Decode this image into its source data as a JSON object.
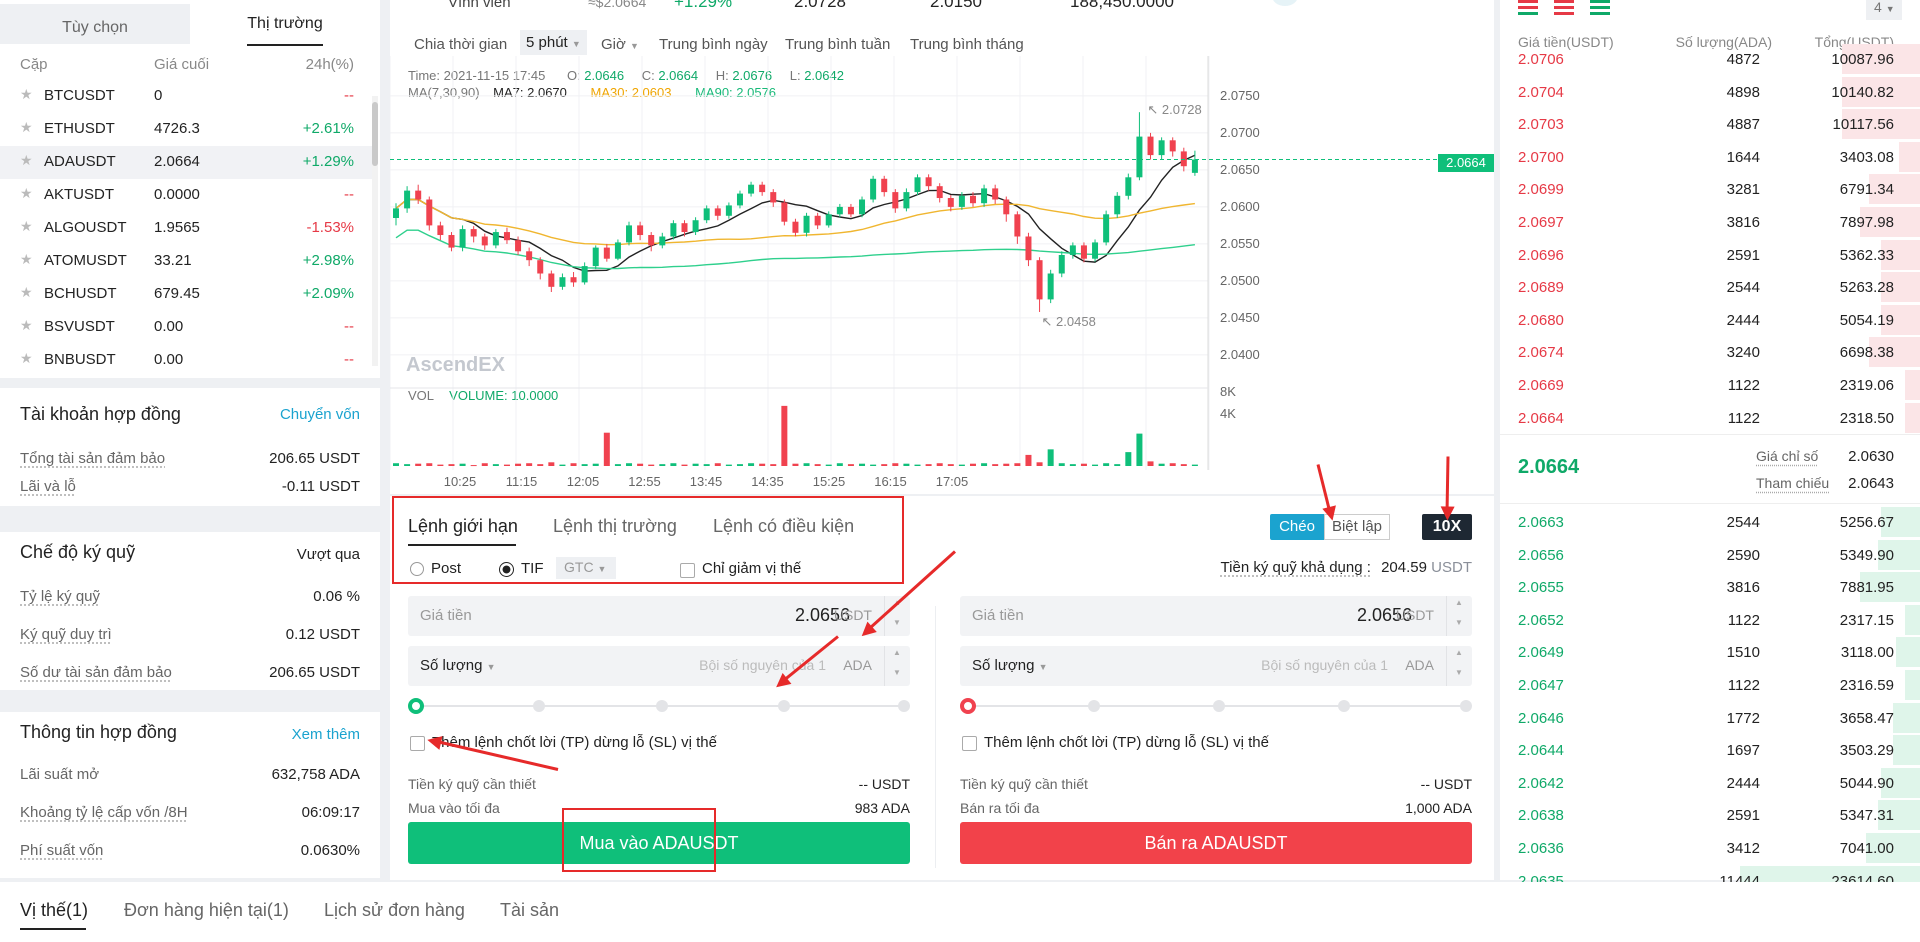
{
  "left": {
    "tabs": [
      "Tùy chọn",
      "Thị trường"
    ],
    "headers": [
      "Cặp",
      "Giá cuối",
      "24h(%)"
    ],
    "markets": [
      {
        "sym": "BTCUSDT",
        "price": "0",
        "chg": "--",
        "dir": "red"
      },
      {
        "sym": "ETHUSDT",
        "price": "4726.3",
        "chg": "+2.61%",
        "dir": "green"
      },
      {
        "sym": "ADAUSDT",
        "price": "2.0664",
        "chg": "+1.29%",
        "dir": "green"
      },
      {
        "sym": "AKTUSDT",
        "price": "0.0000",
        "chg": "--",
        "dir": "red"
      },
      {
        "sym": "ALGOUSDT",
        "price": "1.9565",
        "chg": "-1.53%",
        "dir": "red"
      },
      {
        "sym": "ATOMUSDT",
        "price": "33.21",
        "chg": "+2.98%",
        "dir": "green"
      },
      {
        "sym": "BCHUSDT",
        "price": "679.45",
        "chg": "+2.09%",
        "dir": "green"
      },
      {
        "sym": "BSVUSDT",
        "price": "0.00",
        "chg": "--",
        "dir": "red"
      },
      {
        "sym": "BNBUSDT",
        "price": "0.00",
        "chg": "--",
        "dir": "red"
      }
    ],
    "account": {
      "title": "Tài khoản hợp đồng",
      "link": "Chuyển vốn",
      "rows": [
        [
          "Tổng tài sản đảm bảo",
          "206.65 USDT"
        ],
        [
          "Lãi và lỗ",
          "-0.11 USDT"
        ]
      ]
    },
    "margin": {
      "title": "Chế độ ký quỹ",
      "mode": "Vượt qua",
      "rows": [
        [
          "Tỷ lệ ký quỹ",
          "0.06 %"
        ],
        [
          "Ký quỹ duy trì",
          "0.12 USDT"
        ],
        [
          "Số dư tài sản đảm bảo",
          "206.65 USDT"
        ]
      ]
    },
    "contract": {
      "title": "Thông tin hợp đồng",
      "link": "Xem thêm",
      "rows": [
        [
          "Lãi suất mở",
          "632,758 ADA"
        ],
        [
          "Khoảng tỷ lệ cấp vốn /8H",
          "06:09:17"
        ],
        [
          "Phí suất vốn",
          "0.0630%"
        ]
      ]
    }
  },
  "header": {
    "label": "Vĩnh viễn",
    "approx": "≈$2.0664",
    "change": "+1.29%",
    "high": "2.0728",
    "low": "2.0150",
    "volume": "188,450.0000"
  },
  "chart": {
    "timeframes": [
      "Chia thời gian",
      "5 phút",
      "Giờ",
      "Trung bình ngày",
      "Trung bình tuần",
      "Trung bình tháng"
    ],
    "info": {
      "time": "Time: 2021-11-15 17:45",
      "o_label": "O:",
      "o": "2.0646",
      "c_label": "C:",
      "c": "2.0664",
      "h_label": "H:",
      "h": "2.0676",
      "l_label": "L:",
      "l": "2.0642"
    },
    "ma": {
      "label": "MA(7,30,90)",
      "ma7": "MA7: 2.0670",
      "ma30": "MA30: 2.0603",
      "ma90": "MA90: 2.0576"
    },
    "vol": {
      "label": "VOL",
      "volume": "VOLUME: 10.0000"
    },
    "watermark": "AscendEX",
    "last_price": "2.0664",
    "high_mark": "2.0728",
    "low_mark": "2.0458",
    "colors": {
      "up": "#0fbf7a",
      "down": "#f0424f",
      "ma7": "#222222",
      "ma30": "#f0b630",
      "ma90": "#2fd08d"
    }
  },
  "chart_data": {
    "type": "candlestick",
    "title": "",
    "y_ticks": [
      "2.0750",
      "2.0700",
      "2.0650",
      "2.0600",
      "2.0550",
      "2.0500",
      "2.0450",
      "2.0400"
    ],
    "ylim": [
      2.0385,
      2.0785
    ],
    "x_ticks": [
      "10:25",
      "11:15",
      "12:05",
      "12:55",
      "13:45",
      "14:35",
      "15:25",
      "16:15",
      "17:05"
    ],
    "vol_ticks": [
      "8K",
      "4K"
    ],
    "candles": [
      [
        2.0585,
        2.0598,
        2.0575,
        2.0605
      ],
      [
        2.0598,
        2.0622,
        2.0592,
        2.0628
      ],
      [
        2.0622,
        2.061,
        2.0604,
        2.063
      ],
      [
        2.061,
        2.0575,
        2.0568,
        2.0614
      ],
      [
        2.0575,
        2.0562,
        2.0555,
        2.058
      ],
      [
        2.0562,
        2.0545,
        2.054,
        2.0566
      ],
      [
        2.0545,
        2.057,
        2.054,
        2.0575
      ],
      [
        2.057,
        2.056,
        2.0552,
        2.0574
      ],
      [
        2.056,
        2.0548,
        2.0542,
        2.0564
      ],
      [
        2.0548,
        2.0566,
        2.0544,
        2.057
      ],
      [
        2.0566,
        2.0555,
        2.055,
        2.0572
      ],
      [
        2.0555,
        2.054,
        2.0535,
        2.056
      ],
      [
        2.054,
        2.0528,
        2.052,
        2.0545
      ],
      [
        2.0528,
        2.051,
        2.0502,
        2.0532
      ],
      [
        2.051,
        2.0492,
        2.0485,
        2.0514
      ],
      [
        2.0492,
        2.0505,
        2.0488,
        2.051
      ],
      [
        2.0505,
        2.0498,
        2.0492,
        2.0512
      ],
      [
        2.0498,
        2.052,
        2.0495,
        2.0525
      ],
      [
        2.052,
        2.0545,
        2.0516,
        2.0548
      ],
      [
        2.0545,
        2.053,
        2.0526,
        2.055
      ],
      [
        2.053,
        2.0552,
        2.0528,
        2.0556
      ],
      [
        2.0552,
        2.0575,
        2.0548,
        2.058
      ],
      [
        2.0575,
        2.0562,
        2.0555,
        2.058
      ],
      [
        2.0562,
        2.0548,
        2.054,
        2.0566
      ],
      [
        2.0548,
        2.056,
        2.0544,
        2.0565
      ],
      [
        2.056,
        2.0578,
        2.0556,
        2.0582
      ],
      [
        2.0578,
        2.0566,
        2.056,
        2.0582
      ],
      [
        2.0566,
        2.0582,
        2.0562,
        2.0586
      ],
      [
        2.0582,
        2.0598,
        2.0578,
        2.0602
      ],
      [
        2.0598,
        2.0588,
        2.0582,
        2.0602
      ],
      [
        2.0588,
        2.0602,
        2.0584,
        2.0606
      ],
      [
        2.0602,
        2.0618,
        2.0598,
        2.0622
      ],
      [
        2.0618,
        2.063,
        2.0614,
        2.0634
      ],
      [
        2.063,
        2.062,
        2.0615,
        2.0634
      ],
      [
        2.062,
        2.0606,
        2.06,
        2.0624
      ],
      [
        2.0606,
        2.058,
        2.0575,
        2.061
      ],
      [
        2.058,
        2.0565,
        2.056,
        2.0584
      ],
      [
        2.0565,
        2.0588,
        2.056,
        2.0592
      ],
      [
        2.0588,
        2.0575,
        2.057,
        2.0592
      ],
      [
        2.0575,
        2.059,
        2.0572,
        2.0594
      ],
      [
        2.059,
        2.06,
        2.0586,
        2.0604
      ],
      [
        2.06,
        2.059,
        2.0586,
        2.0604
      ],
      [
        2.059,
        2.061,
        2.0586,
        2.0614
      ],
      [
        2.061,
        2.0638,
        2.0606,
        2.0642
      ],
      [
        2.0638,
        2.062,
        2.0614,
        2.0642
      ],
      [
        2.062,
        2.0598,
        2.0592,
        2.0624
      ],
      [
        2.0598,
        2.062,
        2.0594,
        2.0625
      ],
      [
        2.062,
        2.064,
        2.0616,
        2.0644
      ],
      [
        2.064,
        2.0628,
        2.0622,
        2.0644
      ],
      [
        2.0628,
        2.0612,
        2.0606,
        2.0632
      ],
      [
        2.0612,
        2.06,
        2.0594,
        2.0616
      ],
      [
        2.06,
        2.0615,
        2.0596,
        2.062
      ],
      [
        2.0615,
        2.0605,
        2.06,
        2.062
      ],
      [
        2.0605,
        2.0625,
        2.06,
        2.063
      ],
      [
        2.0625,
        2.061,
        2.0604,
        2.063
      ],
      [
        2.061,
        2.059,
        2.058,
        2.0614
      ],
      [
        2.059,
        2.056,
        2.055,
        2.0594
      ],
      [
        2.056,
        2.0528,
        2.052,
        2.0565
      ],
      [
        2.0528,
        2.0475,
        2.0458,
        2.0532
      ],
      [
        2.0475,
        2.051,
        2.047,
        2.0515
      ],
      [
        2.051,
        2.0535,
        2.0505,
        2.054
      ],
      [
        2.0535,
        2.0548,
        2.053,
        2.0552
      ],
      [
        2.0548,
        2.053,
        2.0525,
        2.0552
      ],
      [
        2.053,
        2.0552,
        2.0526,
        2.0556
      ],
      [
        2.0552,
        2.059,
        2.0548,
        2.0595
      ],
      [
        2.059,
        2.0615,
        2.0585,
        2.062
      ],
      [
        2.0615,
        2.064,
        2.061,
        2.0645
      ],
      [
        2.064,
        2.0695,
        2.0636,
        2.0728
      ],
      [
        2.0695,
        2.067,
        2.0664,
        2.07
      ],
      [
        2.067,
        2.069,
        2.0664,
        2.0694
      ],
      [
        2.069,
        2.0675,
        2.0668,
        2.0694
      ],
      [
        2.0675,
        2.0655,
        2.0648,
        2.068
      ],
      [
        2.0646,
        2.0664,
        2.0642,
        2.0676
      ]
    ],
    "volumes": [
      300,
      200,
      250,
      300,
      150,
      200,
      250,
      100,
      300,
      200,
      150,
      250,
      300,
      200,
      400,
      150,
      300,
      200,
      250,
      3600,
      200,
      300,
      250,
      150,
      200,
      300,
      150,
      250,
      200,
      300,
      150,
      200,
      300,
      250,
      200,
      6500,
      250,
      300,
      200,
      150,
      300,
      200,
      250,
      150,
      200,
      300,
      250,
      150,
      200,
      300,
      200,
      150,
      250,
      300,
      200,
      250,
      300,
      1200,
      400,
      1800,
      300,
      200,
      250,
      150,
      300,
      200,
      1500,
      3500,
      500,
      250,
      300,
      200,
      150
    ]
  },
  "order": {
    "tabs": [
      "Lệnh giới hạn",
      "Lệnh thị trường",
      "Lệnh có điều kiện"
    ],
    "margin_modes": [
      "Chéo",
      "Biệt lập"
    ],
    "leverage": "10X",
    "post": "Post",
    "tif": "TIF",
    "tif_value": "GTC",
    "reduce_only": "Chỉ giảm vị thế",
    "available_label": "Tiền ký quỹ khả dụng :",
    "available_value": "204.59",
    "available_unit": "USDT",
    "price_label": "Giá tiền",
    "price_value": "2.0656",
    "price_unit": "USDT",
    "qty_label": "Số lượng",
    "qty_placeholder": "Bội số nguyên của 1",
    "qty_unit": "ADA",
    "tpsl": "Thêm lệnh chốt lời (TP) dừng lỗ (SL) vị thế",
    "required_label": "Tiền ký quỹ cần thiết",
    "required_value": "-- USDT",
    "buy_max_label": "Mua vào tối đa",
    "buy_max_value": "983 ADA",
    "sell_max_label": "Bán ra tối đa",
    "sell_max_value": "1,000 ADA",
    "buy_btn": "Mua vào ADAUSDT",
    "sell_btn": "Bán ra ADAUSDT"
  },
  "orderbook": {
    "precision": "4",
    "headers": [
      "Giá tiền(USDT)",
      "Số lượng(ADA)",
      "Tổng(USDT)"
    ],
    "asks": [
      [
        "2.0706",
        "4872",
        "10087.96",
        0.26
      ],
      [
        "2.0704",
        "4898",
        "10140.82",
        0.26
      ],
      [
        "2.0703",
        "4887",
        "10117.56",
        0.26
      ],
      [
        "2.0700",
        "1644",
        "3403.08",
        0.07
      ],
      [
        "2.0699",
        "3281",
        "6791.34",
        0.17
      ],
      [
        "2.0697",
        "3816",
        "7897.98",
        0.2
      ],
      [
        "2.0696",
        "2591",
        "5362.33",
        0.13
      ],
      [
        "2.0689",
        "2544",
        "5263.28",
        0.13
      ],
      [
        "2.0680",
        "2444",
        "5054.19",
        0.13
      ],
      [
        "2.0674",
        "3240",
        "6698.38",
        0.17
      ],
      [
        "2.0669",
        "1122",
        "2319.06",
        0.05
      ],
      [
        "2.0664",
        "1122",
        "2318.50",
        0.05
      ]
    ],
    "mid": "2.0664",
    "index_label": "Giá chỉ số",
    "index_value": "2.0630",
    "ref_label": "Tham chiếu",
    "ref_value": "2.0643",
    "bids": [
      [
        "2.0663",
        "2544",
        "5256.67",
        0.13
      ],
      [
        "2.0656",
        "2590",
        "5349.90",
        0.14
      ],
      [
        "2.0655",
        "3816",
        "7881.95",
        0.2
      ],
      [
        "2.0652",
        "1122",
        "2317.15",
        0.05
      ],
      [
        "2.0649",
        "1510",
        "3118.00",
        0.08
      ],
      [
        "2.0647",
        "1122",
        "2316.59",
        0.05
      ],
      [
        "2.0646",
        "1772",
        "3658.47",
        0.09
      ],
      [
        "2.0644",
        "1697",
        "3503.29",
        0.09
      ],
      [
        "2.0642",
        "2444",
        "5044.90",
        0.13
      ],
      [
        "2.0638",
        "2591",
        "5347.31",
        0.14
      ],
      [
        "2.0636",
        "3412",
        "7041.00",
        0.18
      ],
      [
        "2.0635",
        "11444",
        "23614.60",
        0.6
      ]
    ]
  },
  "bottom": {
    "tabs": [
      "Vị thế(1)",
      "Đơn hàng hiện tại(1)",
      "Lịch sử đơn hàng",
      "Tài sản"
    ]
  }
}
